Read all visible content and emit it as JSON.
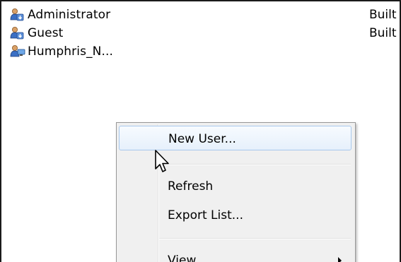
{
  "users": [
    {
      "name": "Administrator",
      "description": "Built",
      "icon": "user-admin-icon"
    },
    {
      "name": "Guest",
      "description": "Built",
      "icon": "user-guest-icon"
    },
    {
      "name": "Humphris_N...",
      "description": "",
      "icon": "user-icon"
    }
  ],
  "context_menu": {
    "items": [
      {
        "label": "New User...",
        "highlighted": true
      },
      {
        "label": "Refresh"
      },
      {
        "label": "Export List..."
      },
      {
        "label": "View",
        "has_submenu": true
      }
    ]
  },
  "colors": {
    "highlight_border": "#a8c8ec",
    "menu_background": "#f0f0f0"
  }
}
